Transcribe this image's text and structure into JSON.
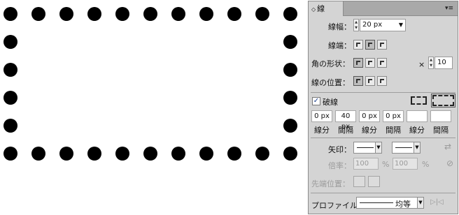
{
  "panel": {
    "tab_title": "線",
    "tab_arrows": "◇",
    "menu_icon": "panel-menu-icon",
    "stroke_weight": {
      "label": "線幅：",
      "value": "20 px"
    },
    "cap": {
      "label": "線端："
    },
    "corner": {
      "label": "角の形状：",
      "miter_x": "×",
      "miter_value": "10"
    },
    "align": {
      "label": "線の位置："
    },
    "dashed": {
      "label": "破線",
      "checked": true
    },
    "dash_values": [
      "0 px",
      "40 px",
      "0 px",
      "0 px",
      "",
      ""
    ],
    "dash_labels": [
      "線分",
      "間隔",
      "線分",
      "間隔",
      "線分",
      "間隔"
    ],
    "arrowheads": {
      "label": "矢印："
    },
    "scale": {
      "label": "倍率：",
      "value1": "100",
      "value2": "100",
      "unit": "%"
    },
    "align_arrow": {
      "label": "先端位置："
    },
    "profile": {
      "label": "プロファイル：",
      "value": "均等"
    }
  },
  "canvas": {
    "dot_color": "#000000"
  }
}
